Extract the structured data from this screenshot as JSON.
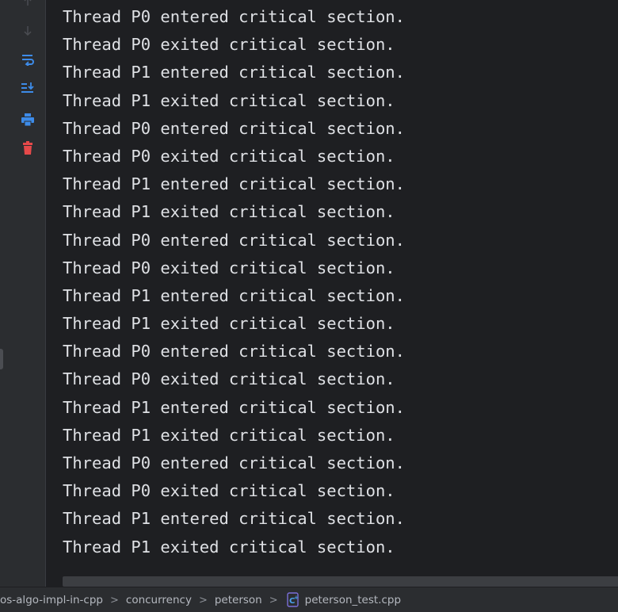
{
  "console": {
    "lines": [
      "Thread P0 entered critical section.",
      "Thread P0 exited critical section.",
      "Thread P1 entered critical section.",
      "Thread P1 exited critical section.",
      "Thread P0 entered critical section.",
      "Thread P0 exited critical section.",
      "Thread P1 entered critical section.",
      "Thread P1 exited critical section.",
      "Thread P0 entered critical section.",
      "Thread P0 exited critical section.",
      "Thread P1 entered critical section.",
      "Thread P1 exited critical section.",
      "Thread P0 entered critical section.",
      "Thread P0 exited critical section.",
      "Thread P1 entered critical section.",
      "Thread P1 exited critical section.",
      "Thread P0 entered critical section.",
      "Thread P0 exited critical section.",
      "Thread P1 entered critical section.",
      "Thread P1 exited critical section."
    ]
  },
  "toolbar": {
    "icons": [
      "arrow-down-icon",
      "soft-wrap-icon",
      "scroll-to-end-icon",
      "print-icon",
      "trash-icon"
    ]
  },
  "breadcrumb": {
    "items": [
      "os-algo-impl-in-cpp",
      "concurrency",
      "peterson",
      "peterson_test.cpp"
    ],
    "separator": ">"
  },
  "colors": {
    "accent": "#3d8be8",
    "danger": "#e5494a",
    "text": "#dfe1e5",
    "background": "#1e1f22"
  }
}
